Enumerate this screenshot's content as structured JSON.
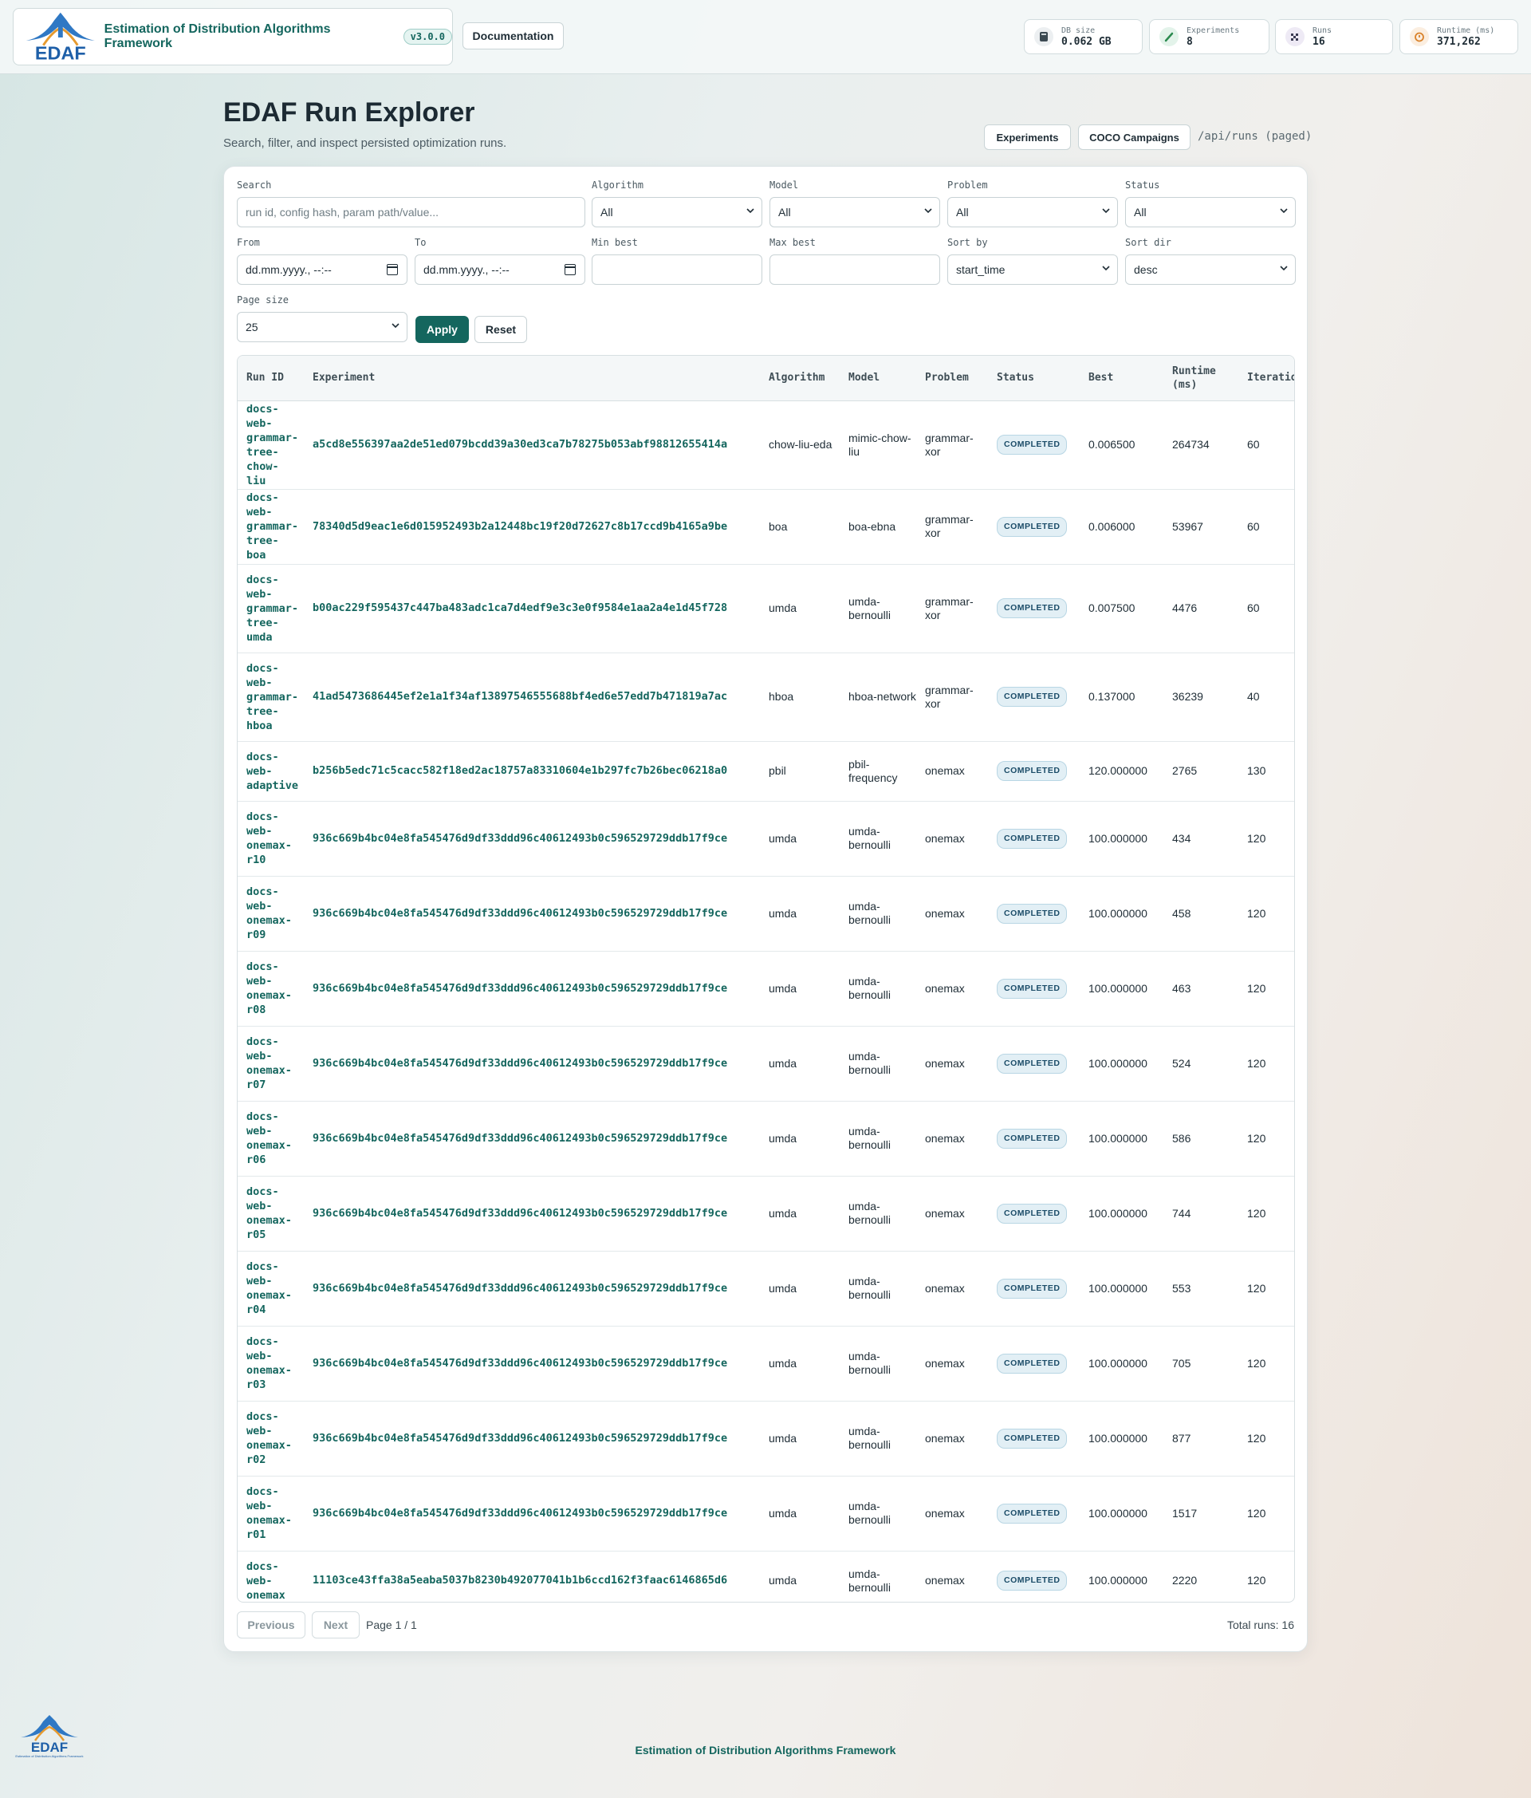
{
  "header": {
    "logo_text": "EDAF",
    "app_title": "Estimation of Distribution Algorithms Framework",
    "version": "v3.0.0",
    "documentation_label": "Documentation",
    "stats": [
      {
        "label": "DB size",
        "value": "0.062 GB",
        "icon": "database-icon"
      },
      {
        "label": "Experiments",
        "value": "8",
        "icon": "flask-icon"
      },
      {
        "label": "Runs",
        "value": "16",
        "icon": "checkered-flag-icon"
      },
      {
        "label": "Runtime (ms)",
        "value": "371,262",
        "icon": "timer-icon"
      }
    ]
  },
  "page": {
    "title": "EDAF Run Explorer",
    "subtitle": "Search, filter, and inspect persisted optimization runs.",
    "nav": {
      "experiments": "Experiments",
      "coco": "COCO Campaigns"
    },
    "api_path": "/api/runs (paged)"
  },
  "filters": {
    "search": {
      "label": "Search",
      "placeholder": "run id, config hash, param path/value..."
    },
    "algorithm": {
      "label": "Algorithm",
      "value": "All"
    },
    "model": {
      "label": "Model",
      "value": "All"
    },
    "problem": {
      "label": "Problem",
      "value": "All"
    },
    "status": {
      "label": "Status",
      "value": "All"
    },
    "from": {
      "label": "From",
      "placeholder": "dd.mm.yyyy., --:--"
    },
    "to": {
      "label": "To",
      "placeholder": "dd.mm.yyyy., --:--"
    },
    "min_best": {
      "label": "Min best",
      "value": ""
    },
    "max_best": {
      "label": "Max best",
      "value": ""
    },
    "sort_by": {
      "label": "Sort by",
      "value": "start_time"
    },
    "sort_dir": {
      "label": "Sort dir",
      "value": "desc"
    },
    "page_size": {
      "label": "Page size",
      "value": "25"
    },
    "apply_label": "Apply",
    "reset_label": "Reset"
  },
  "table": {
    "columns": [
      "Run ID",
      "Experiment",
      "Algorithm",
      "Model",
      "Problem",
      "Status",
      "Best",
      "Runtime (ms)",
      "Iterations"
    ],
    "rows": [
      {
        "run_id": "docs-web-grammar-tree-chow-liu",
        "experiment": "a5cd8e556397aa2de51ed079bcdd39a30ed3ca7b78275b053abf98812655414a",
        "algorithm": "chow-liu-eda",
        "model": "mimic-chow-liu",
        "problem": "grammar-xor",
        "status": "COMPLETED",
        "best": "0.006500",
        "runtime": "264734",
        "iterations": "60"
      },
      {
        "run_id": "docs-web-grammar-tree-boa",
        "experiment": "78340d5d9eac1e6d015952493b2a12448bc19f20d72627c8b17ccd9b4165a9be",
        "algorithm": "boa",
        "model": "boa-ebna",
        "problem": "grammar-xor",
        "status": "COMPLETED",
        "best": "0.006000",
        "runtime": "53967",
        "iterations": "60"
      },
      {
        "run_id": "docs-web-grammar-tree-umda",
        "experiment": "b00ac229f595437c447ba483adc1ca7d4edf9e3c3e0f9584e1aa2a4e1d45f728",
        "algorithm": "umda",
        "model": "umda-bernoulli",
        "problem": "grammar-xor",
        "status": "COMPLETED",
        "best": "0.007500",
        "runtime": "4476",
        "iterations": "60"
      },
      {
        "run_id": "docs-web-grammar-tree-hboa",
        "experiment": "41ad5473686445ef2e1a1f34af13897546555688bf4ed6e57edd7b471819a7ac",
        "algorithm": "hboa",
        "model": "hboa-network",
        "problem": "grammar-xor",
        "status": "COMPLETED",
        "best": "0.137000",
        "runtime": "36239",
        "iterations": "40"
      },
      {
        "run_id": "docs-web-adaptive",
        "experiment": "b256b5edc71c5cacc582f18ed2ac18757a83310604e1b297fc7b26bec06218a0",
        "algorithm": "pbil",
        "model": "pbil-frequency",
        "problem": "onemax",
        "status": "COMPLETED",
        "best": "120.000000",
        "runtime": "2765",
        "iterations": "130"
      },
      {
        "run_id": "docs-web-onemax-r10",
        "experiment": "936c669b4bc04e8fa545476d9df33ddd96c40612493b0c596529729ddb17f9ce",
        "algorithm": "umda",
        "model": "umda-bernoulli",
        "problem": "onemax",
        "status": "COMPLETED",
        "best": "100.000000",
        "runtime": "434",
        "iterations": "120"
      },
      {
        "run_id": "docs-web-onemax-r09",
        "experiment": "936c669b4bc04e8fa545476d9df33ddd96c40612493b0c596529729ddb17f9ce",
        "algorithm": "umda",
        "model": "umda-bernoulli",
        "problem": "onemax",
        "status": "COMPLETED",
        "best": "100.000000",
        "runtime": "458",
        "iterations": "120"
      },
      {
        "run_id": "docs-web-onemax-r08",
        "experiment": "936c669b4bc04e8fa545476d9df33ddd96c40612493b0c596529729ddb17f9ce",
        "algorithm": "umda",
        "model": "umda-bernoulli",
        "problem": "onemax",
        "status": "COMPLETED",
        "best": "100.000000",
        "runtime": "463",
        "iterations": "120"
      },
      {
        "run_id": "docs-web-onemax-r07",
        "experiment": "936c669b4bc04e8fa545476d9df33ddd96c40612493b0c596529729ddb17f9ce",
        "algorithm": "umda",
        "model": "umda-bernoulli",
        "problem": "onemax",
        "status": "COMPLETED",
        "best": "100.000000",
        "runtime": "524",
        "iterations": "120"
      },
      {
        "run_id": "docs-web-onemax-r06",
        "experiment": "936c669b4bc04e8fa545476d9df33ddd96c40612493b0c596529729ddb17f9ce",
        "algorithm": "umda",
        "model": "umda-bernoulli",
        "problem": "onemax",
        "status": "COMPLETED",
        "best": "100.000000",
        "runtime": "586",
        "iterations": "120"
      },
      {
        "run_id": "docs-web-onemax-r05",
        "experiment": "936c669b4bc04e8fa545476d9df33ddd96c40612493b0c596529729ddb17f9ce",
        "algorithm": "umda",
        "model": "umda-bernoulli",
        "problem": "onemax",
        "status": "COMPLETED",
        "best": "100.000000",
        "runtime": "744",
        "iterations": "120"
      },
      {
        "run_id": "docs-web-onemax-r04",
        "experiment": "936c669b4bc04e8fa545476d9df33ddd96c40612493b0c596529729ddb17f9ce",
        "algorithm": "umda",
        "model": "umda-bernoulli",
        "problem": "onemax",
        "status": "COMPLETED",
        "best": "100.000000",
        "runtime": "553",
        "iterations": "120"
      },
      {
        "run_id": "docs-web-onemax-r03",
        "experiment": "936c669b4bc04e8fa545476d9df33ddd96c40612493b0c596529729ddb17f9ce",
        "algorithm": "umda",
        "model": "umda-bernoulli",
        "problem": "onemax",
        "status": "COMPLETED",
        "best": "100.000000",
        "runtime": "705",
        "iterations": "120"
      },
      {
        "run_id": "docs-web-onemax-r02",
        "experiment": "936c669b4bc04e8fa545476d9df33ddd96c40612493b0c596529729ddb17f9ce",
        "algorithm": "umda",
        "model": "umda-bernoulli",
        "problem": "onemax",
        "status": "COMPLETED",
        "best": "100.000000",
        "runtime": "877",
        "iterations": "120"
      },
      {
        "run_id": "docs-web-onemax-r01",
        "experiment": "936c669b4bc04e8fa545476d9df33ddd96c40612493b0c596529729ddb17f9ce",
        "algorithm": "umda",
        "model": "umda-bernoulli",
        "problem": "onemax",
        "status": "COMPLETED",
        "best": "100.000000",
        "runtime": "1517",
        "iterations": "120"
      },
      {
        "run_id": "docs-web-onemax",
        "experiment": "11103ce43ffa38a5eaba5037b8230b492077041b1b6ccd162f3faac6146865d6",
        "algorithm": "umda",
        "model": "umda-bernoulli",
        "problem": "onemax",
        "status": "COMPLETED",
        "best": "100.000000",
        "runtime": "2220",
        "iterations": "120"
      }
    ]
  },
  "pagination": {
    "previous_label": "Previous",
    "next_label": "Next",
    "page_info": "Page 1 / 1",
    "total_runs": "Total runs: 16"
  },
  "footer": {
    "logo_text": "EDAF",
    "text": "Estimation of Distribution Algorithms Framework"
  },
  "colors": {
    "accent": "#14665e",
    "badge": "#1b4c68",
    "logo_blue": "#1e5fa8"
  }
}
